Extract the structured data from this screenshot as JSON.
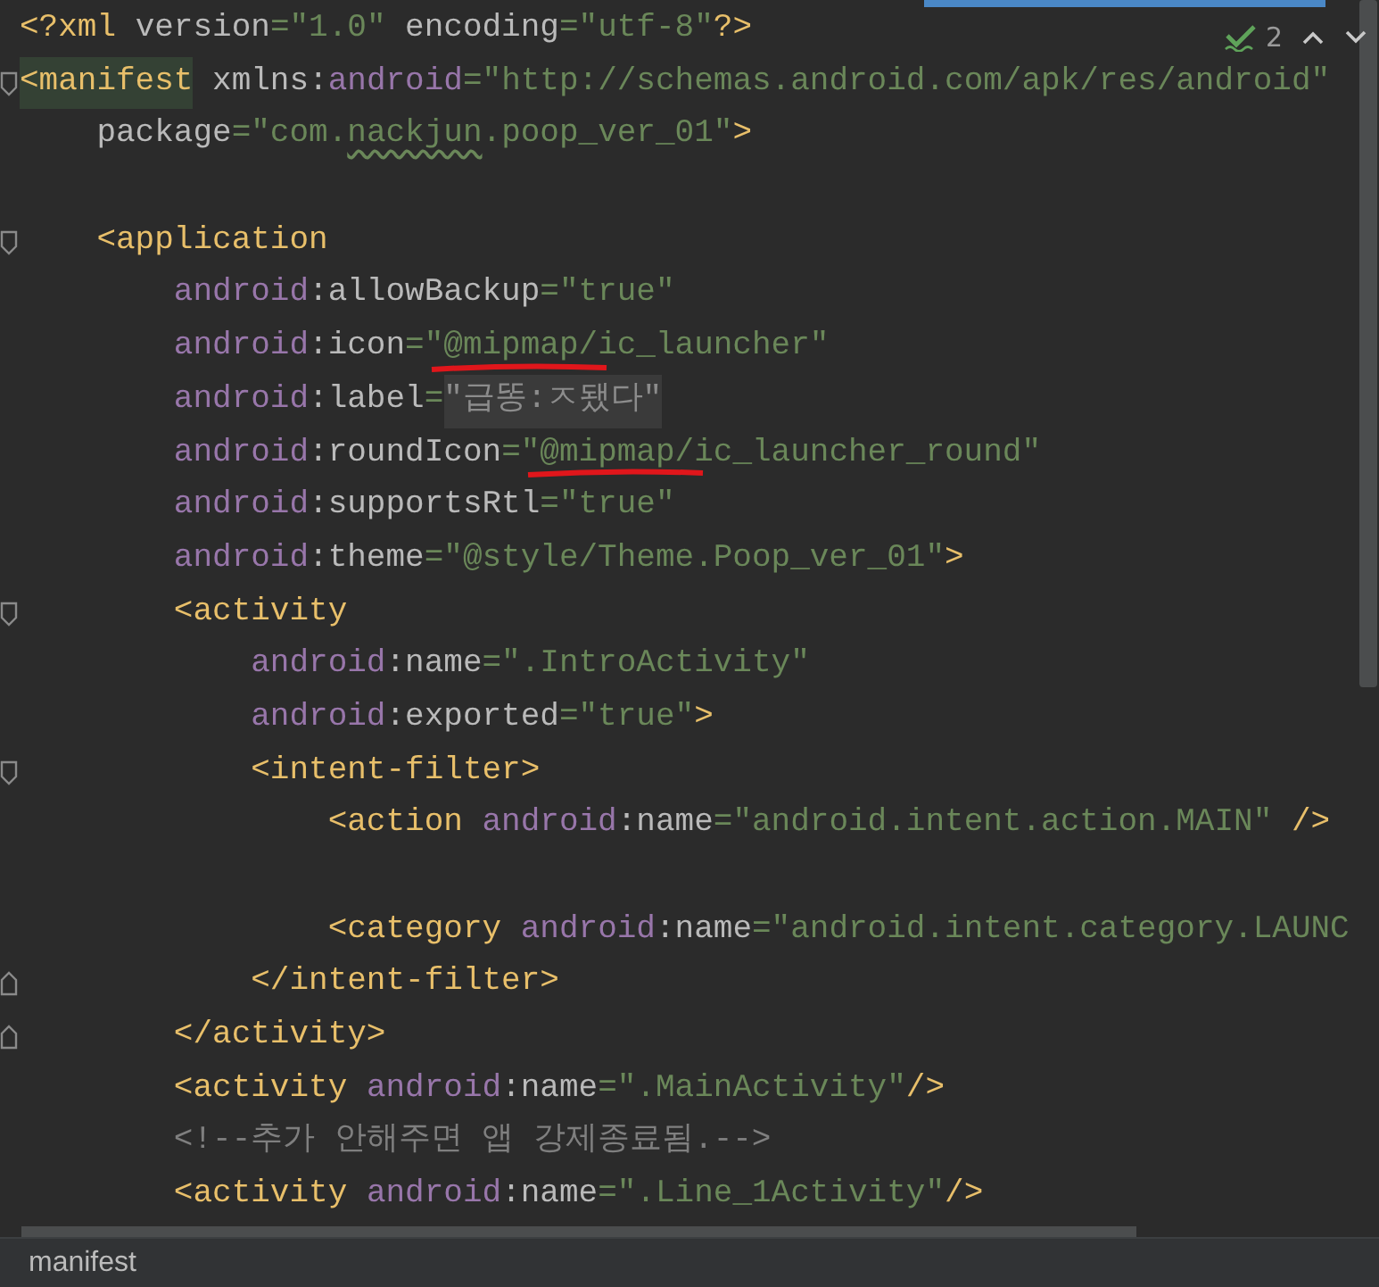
{
  "editor": {
    "inspection": {
      "count": "2"
    },
    "lines": [
      {
        "tokens": [
          {
            "kind": "tag",
            "text": "<?xml"
          },
          {
            "kind": "attr",
            "text": " version"
          },
          {
            "kind": "value",
            "text": "=\"1.0\""
          },
          {
            "kind": "attr",
            "text": " encoding"
          },
          {
            "kind": "value",
            "text": "=\"utf-8\""
          },
          {
            "kind": "tag",
            "text": "?>"
          }
        ]
      },
      {
        "fold_start": true,
        "tokens": [
          {
            "kind": "tag",
            "text": "<manifest",
            "highlighted": true
          },
          {
            "kind": "attr",
            "text": " xmlns:"
          },
          {
            "kind": "ns",
            "text": "android"
          },
          {
            "kind": "value",
            "text": "=\"http://schemas.android.com/apk/res/android\""
          }
        ]
      },
      {
        "tokens": [
          {
            "kind": "attr",
            "text": "    package"
          },
          {
            "kind": "value",
            "text": "=\"com."
          },
          {
            "kind": "value",
            "text": "nackjun",
            "typo": true
          },
          {
            "kind": "value",
            "text": ".poop_ver_01\""
          },
          {
            "kind": "tag",
            "text": ">"
          }
        ]
      },
      {
        "fold_start": true,
        "blank_before": true,
        "tokens": [
          {
            "kind": "tag",
            "text": "    <application"
          }
        ]
      },
      {
        "tokens": [
          {
            "kind": "ns",
            "text": "        android"
          },
          {
            "kind": "attr",
            "text": ":allowBackup"
          },
          {
            "kind": "value",
            "text": "=\"true\""
          }
        ]
      },
      {
        "tokens": [
          {
            "kind": "ns",
            "text": "        android"
          },
          {
            "kind": "attr",
            "text": ":icon"
          },
          {
            "kind": "value",
            "text": "=\""
          },
          {
            "kind": "value",
            "text": "@mipmap/ic_launcher\"",
            "annotated": true
          }
        ]
      },
      {
        "tokens": [
          {
            "kind": "ns",
            "text": "        android"
          },
          {
            "kind": "attr",
            "text": ":label"
          },
          {
            "kind": "value",
            "text": "="
          },
          {
            "kind": "folded",
            "text": "\"급똥:ㅈ됐다\""
          }
        ]
      },
      {
        "tokens": [
          {
            "kind": "ns",
            "text": "        android"
          },
          {
            "kind": "attr",
            "text": ":roundIcon"
          },
          {
            "kind": "value",
            "text": "=\""
          },
          {
            "kind": "value",
            "text": "@mipmap/ic_launcher_round\"",
            "annotated": true
          }
        ]
      },
      {
        "tokens": [
          {
            "kind": "ns",
            "text": "        android"
          },
          {
            "kind": "attr",
            "text": ":supportsRtl"
          },
          {
            "kind": "value",
            "text": "=\"true\""
          }
        ]
      },
      {
        "tokens": [
          {
            "kind": "ns",
            "text": "        android"
          },
          {
            "kind": "attr",
            "text": ":theme"
          },
          {
            "kind": "value",
            "text": "=\"@style/Theme.Poop_ver_01\""
          },
          {
            "kind": "tag",
            "text": ">"
          }
        ]
      },
      {
        "fold_start": true,
        "tokens": [
          {
            "kind": "tag",
            "text": "        <activity"
          }
        ]
      },
      {
        "tokens": [
          {
            "kind": "ns",
            "text": "            android"
          },
          {
            "kind": "attr",
            "text": ":name"
          },
          {
            "kind": "value",
            "text": "=\".IntroActivity\""
          }
        ]
      },
      {
        "tokens": [
          {
            "kind": "ns",
            "text": "            android"
          },
          {
            "kind": "attr",
            "text": ":exported"
          },
          {
            "kind": "value",
            "text": "=\"true\""
          },
          {
            "kind": "tag",
            "text": ">"
          }
        ]
      },
      {
        "fold_start": true,
        "tokens": [
          {
            "kind": "tag",
            "text": "            <intent-filter>"
          }
        ]
      },
      {
        "tokens": [
          {
            "kind": "tag",
            "text": "                <action "
          },
          {
            "kind": "ns",
            "text": "android"
          },
          {
            "kind": "attr",
            "text": ":name"
          },
          {
            "kind": "value",
            "text": "=\"android.intent.action.MAIN\""
          },
          {
            "kind": "tag",
            "text": " />"
          }
        ]
      },
      {
        "blank_before": true,
        "tokens": [
          {
            "kind": "tag",
            "text": "                <category "
          },
          {
            "kind": "ns",
            "text": "android"
          },
          {
            "kind": "attr",
            "text": ":name"
          },
          {
            "kind": "value",
            "text": "=\"android.intent.category.LAUNC"
          }
        ]
      },
      {
        "fold_end": true,
        "tokens": [
          {
            "kind": "tag",
            "text": "            </intent-filter>"
          }
        ]
      },
      {
        "fold_end": true,
        "tokens": [
          {
            "kind": "tag",
            "text": "        </activity>"
          }
        ]
      },
      {
        "tokens": [
          {
            "kind": "tag",
            "text": "        <activity "
          },
          {
            "kind": "ns",
            "text": "android"
          },
          {
            "kind": "attr",
            "text": ":name"
          },
          {
            "kind": "value",
            "text": "=\".MainActivity\""
          },
          {
            "kind": "tag",
            "text": "/>"
          }
        ]
      },
      {
        "tokens": [
          {
            "kind": "comment",
            "text": "        <!--추가 안해주면 앱 강제종료됨.-->"
          }
        ]
      },
      {
        "tokens": [
          {
            "kind": "tag",
            "text": "        <activity "
          },
          {
            "kind": "ns",
            "text": "android"
          },
          {
            "kind": "attr",
            "text": ":name"
          },
          {
            "kind": "value",
            "text": "=\".Line_1Activity\""
          },
          {
            "kind": "tag",
            "text": "/>"
          }
        ]
      }
    ]
  },
  "breadcrumb": {
    "items": [
      {
        "label": "manifest"
      }
    ]
  }
}
